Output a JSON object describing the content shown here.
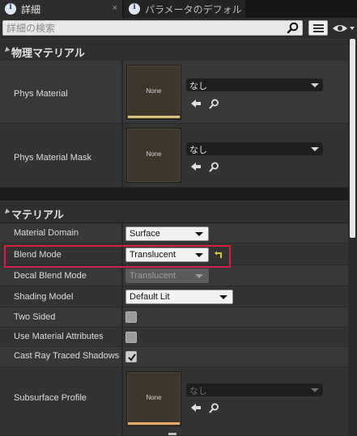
{
  "tabs": [
    {
      "label": "詳細",
      "close": "×"
    },
    {
      "label": "パラメータのデフォル",
      "close": "×"
    }
  ],
  "search": {
    "placeholder": "詳細の検索"
  },
  "categories": {
    "physics": "物理マテリアル",
    "material": "マテリアル"
  },
  "properties": {
    "phys_material": {
      "label": "Phys Material",
      "thumb": "None",
      "value": "なし"
    },
    "phys_material_mask": {
      "label": "Phys Material Mask",
      "thumb": "None",
      "value": "なし"
    },
    "material_domain": {
      "label": "Material Domain",
      "value": "Surface"
    },
    "blend_mode": {
      "label": "Blend Mode",
      "value": "Translucent"
    },
    "decal_blend_mode": {
      "label": "Decal Blend Mode",
      "value": "Translucent"
    },
    "shading_model": {
      "label": "Shading Model",
      "value": "Default Lit"
    },
    "two_sided": {
      "label": "Two Sided",
      "checked": false
    },
    "use_material_attributes": {
      "label": "Use Material Attributes",
      "checked": false
    },
    "cast_ray_traced_shadows": {
      "label": "Cast Ray Traced Shadows",
      "checked": true
    },
    "subsurface_profile": {
      "label": "Subsurface Profile",
      "thumb": "None",
      "value": "なし"
    }
  },
  "colors": {
    "highlight_border": "#d41f45",
    "phys_material_bar": "#d8c07a",
    "subsurface_bar": "#e6a86a",
    "reset_arrow": "#e8d44a"
  },
  "icons": {
    "tab": "info-icon",
    "search": "magnifier-icon",
    "view_options": "eye-icon",
    "browse": "arrow-left-icon",
    "find": "magnifier-icon",
    "reset": "reset-to-default-icon"
  }
}
